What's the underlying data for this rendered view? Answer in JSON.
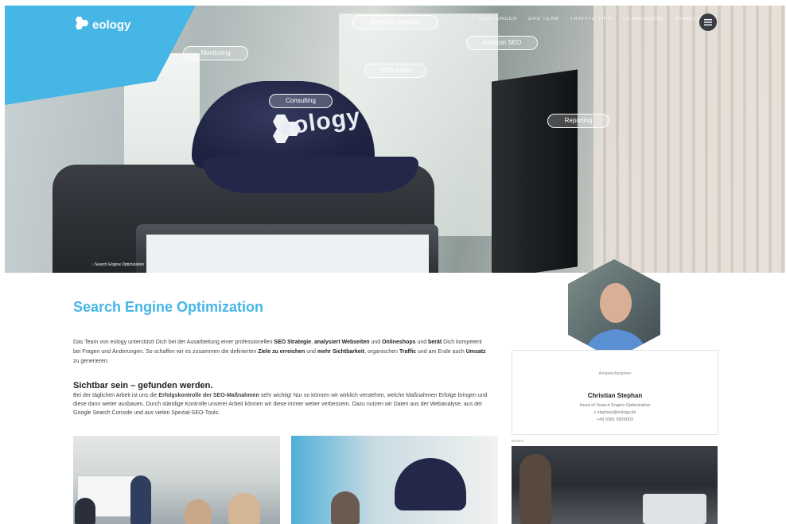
{
  "header": {
    "logo_text": "eology",
    "nav": [
      "LEISTUNGEN",
      "DAS TEAM",
      "TRAFFIC TIPS",
      "E3 MAGAZINE",
      "KARRIERE"
    ]
  },
  "hero": {
    "pills": [
      "Keyword-Analyse",
      "Monitoring",
      "Amazon SEO",
      "SEO Audit",
      "Consulting",
      "Reporting"
    ],
    "breadcrumb": "› Search Engine Optimization",
    "cap_text": "eology"
  },
  "main": {
    "title": "Search Engine Optimization",
    "intro": {
      "t1": "Das Team von eology unterstützt Dich bei der Ausarbeitung einer professionellen ",
      "b1": "SEO Strategie",
      "t2": ", ",
      "b2": "analysiert Webseiten",
      "t3": " und ",
      "b3": "Onlineshops",
      "t4": " und ",
      "b4": "berät",
      "t5": " Dich kompetent bei Fragen und Änderungen. So schaffen wir es zusammen die definierten ",
      "b5": "Ziele zu erreichen",
      "t6": " und ",
      "b6": "mehr Sichtbarkeit",
      "t7": ", organischen ",
      "b7": "Traffic",
      "t8": " und am Ende auch ",
      "b8": "Umsatz",
      "t9": " zu generieren."
    },
    "subtitle": "Sichtbar sein – gefunden werden.",
    "para2": {
      "t1": "Bei der täglichen Arbeit ist uns die ",
      "b1": "Erfolgskontrolle der SEO-Maßnahmen",
      "t2": " sehr wichtig! Nur so können wir wirklich verstehen, welche Maßnahmen Erfolge bringen und diese dann weiter ausbauen. Durch ständige Kontrolle unserer Arbeit können wir diese immer weiter verbessern. Dazu nutzen wir Daten aus der Webanalyse, aus der Google Search Console und aus vielen Spezial-SEO-Tools."
    }
  },
  "contact": {
    "label": "Ansprechpartner",
    "name": "Christian Stephan",
    "role": "Head of Search Engine Optimization",
    "email": "c.stephan@eology.de",
    "phone": "+49 9381 5829003"
  },
  "news_label": "NEWS",
  "colors": {
    "accent": "#45b6e6",
    "dark": "#222222"
  }
}
